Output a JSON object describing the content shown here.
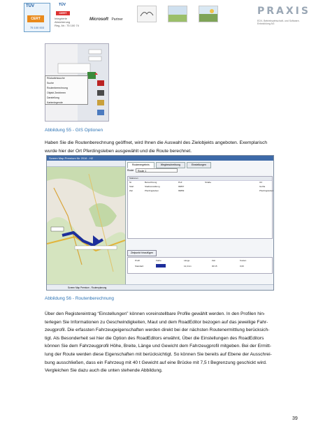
{
  "header": {
    "tuv_badge": {
      "top": "TÜV",
      "cert": "CERT",
      "number": "75 100 003"
    },
    "tuv_cert": {
      "top": "TÜV",
      "cert": "CERT",
      "lines": "Integrierte\nAbsicherung\nReg.-Nr.: 75 100 74"
    },
    "ms_partner": {
      "brand": "Microsoft",
      "partner": "Partner"
    },
    "praxis": {
      "brand": "PRAXIS",
      "sub": "EDV- Betriebswirtschaft- und Software- Entwicklung AG"
    }
  },
  "figure1": {
    "menu_items": [
      "Rückwärtssuche",
      "Suche",
      "Routenberechnung",
      "Objekt Zentrieren",
      "Darstellung",
      "Kartenlegende"
    ],
    "caption": "Abbildung 55 - GIS Optionen"
  },
  "paragraph1": {
    "line1": "Haben Sie die Routenberechnung geöffnet, wird Ihnen die Auswahl des Zielobjekts angeboten. Exemplarisch",
    "line2": "wurde hier der Ort Pferdingsleben ausgewählt und die Route berechnet."
  },
  "figure2": {
    "window_title": "Screen Map Premium für 2016 - H2",
    "tabs": [
      "Routenergebnis",
      "Wegbeschreibung",
      "Einstellungen"
    ],
    "route_label": "Route",
    "route_value": "Route 1",
    "stations_label": "Stationen",
    "columns": [
      "Nr.",
      "Bezeichnung",
      "PLZ",
      "Straße",
      "Ort"
    ],
    "rows": [
      [
        "Start",
        "Stadtverwaltung",
        "99867",
        "",
        "Gotha"
      ],
      [
        "Ziel",
        "Pferdingsleben",
        "99869",
        "",
        "Pferdingsleben"
      ]
    ],
    "add_button": "Zielpunkt hinzufügen",
    "profile_columns": [
      "Profil",
      "Farbe",
      "Länge",
      "Zeit",
      "Kosten"
    ],
    "profile_row": [
      "Standard",
      "",
      "12,4 km",
      "00:15",
      "0,00"
    ],
    "statusbar": "Screen Map Premium - Routenplanung",
    "caption": "Abbildung 56 - Routenberechnung"
  },
  "paragraph2": {
    "lines": [
      "Über den Registereintrag “Einstellungen” können voreinstellbare Profile gewählt werden. In den Profilen hin-",
      "terlegen Sie Informationen zu Geschwindigkeiten, Maut und dem RoadEditor bezogen auf das jeweilige Fahr-",
      "zeugprofil. Die erfassten Fahrzeugeigenschaften werden direkt bei der nächsten Routenermittlung berücksich-",
      "tigt. Als Besonderheit sei hier die Option des RoadEditors erwähnt, Über die Einstellungen des RoadEditors",
      "können Sie dem Fahrzeugprofil Höhe, Breite, Länge und Gewicht dem Fahrzeugprofil mitgeben. Bei der Ermitt-",
      "lung der Route werden diese Eigenschaften mit berücksichtigt. So können Sie bereits auf Ebene der Ausschrei-",
      "bung ausschließen, dass ein Fahrzeug mit 40 t Gewicht auf eine Brücke mit 7,5 t Begrenzung geschickt wird.",
      "Vergleichen Sie dazu auch die unten stehende Abbildung."
    ]
  },
  "page_number": "39"
}
